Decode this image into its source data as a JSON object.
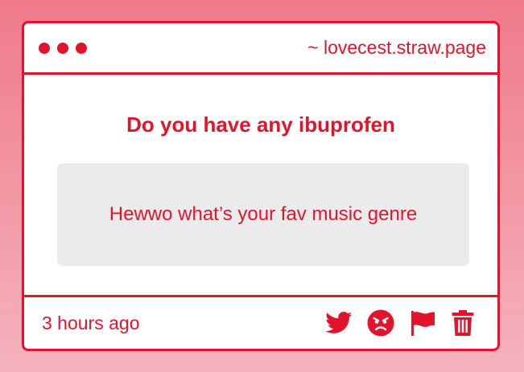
{
  "window": {
    "url": "~ lovecest.straw.page"
  },
  "post": {
    "question": "Do you have any ibuprofen",
    "answer": "Hewwo what’s your fav music genre",
    "timestamp": "3 hours ago"
  },
  "actions": [
    {
      "icon": "twitter-icon"
    },
    {
      "icon": "angry-face-icon"
    },
    {
      "icon": "flag-icon"
    },
    {
      "icon": "trash-icon"
    }
  ],
  "colors": {
    "accent": "#e0142d",
    "answer_bg": "#ecebec",
    "bg_top": "#ef7a8a",
    "bg_bottom": "#f5b3bd"
  }
}
